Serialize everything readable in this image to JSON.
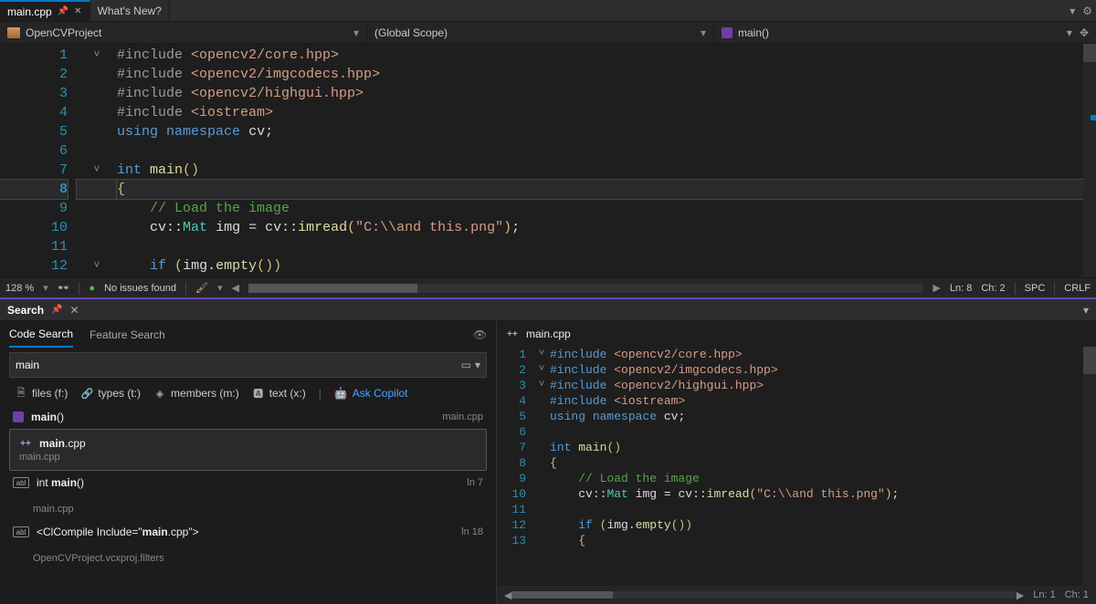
{
  "tabs": {
    "active": "main.cpp",
    "other": "What's New?"
  },
  "nav": {
    "project": "OpenCVProject",
    "scope": "(Global Scope)",
    "member": "main()"
  },
  "editor": {
    "current_line_num": "8",
    "lines": [
      {
        "n": "1",
        "fold": "˅",
        "html": "<span class='tok-pp'>#include</span> <span class='tok-str'>&lt;opencv2/core.hpp&gt;</span>"
      },
      {
        "n": "2",
        "fold": " ",
        "html": "<span class='tok-pp'>#include</span> <span class='tok-str'>&lt;opencv2/imgcodecs.hpp&gt;</span>"
      },
      {
        "n": "3",
        "fold": " ",
        "html": "<span class='tok-pp'>#include</span> <span class='tok-str'>&lt;opencv2/highgui.hpp&gt;</span>"
      },
      {
        "n": "4",
        "fold": " ",
        "html": "<span class='tok-pp'>#include</span> <span class='tok-str'>&lt;iostream&gt;</span>"
      },
      {
        "n": "5",
        "fold": " ",
        "html": "<span class='tok-kw'>using</span> <span class='tok-kw'>namespace</span> <span class='tok-white'>cv;</span>"
      },
      {
        "n": "6",
        "fold": " ",
        "html": " "
      },
      {
        "n": "7",
        "fold": "˅",
        "html": "<span class='tok-kw'>int</span> <span class='tok-func'>main</span><span class='tok-brace'>()</span>"
      },
      {
        "n": "8",
        "fold": " ",
        "html": "<span class='tok-brace'>{</span>",
        "current": true
      },
      {
        "n": "9",
        "fold": " ",
        "html": "    <span class='tok-cmt'>// Load the image</span>"
      },
      {
        "n": "10",
        "fold": " ",
        "html": "    <span class='tok-white'>cv::</span><span class='tok-type'>Mat</span> <span class='tok-white'>img = cv::</span><span class='tok-func'>imread</span><span class='tok-brace'>(</span><span class='tok-str'>\"C:\\\\and this.png\"</span><span class='tok-brace'>)</span><span class='tok-white'>;</span>"
      },
      {
        "n": "11",
        "fold": " ",
        "html": " "
      },
      {
        "n": "12",
        "fold": "˅",
        "html": "    <span class='tok-kw'>if</span> <span class='tok-brace'>(</span><span class='tok-white'>img.</span><span class='tok-func'>empty</span><span class='tok-brace'>())</span>"
      }
    ]
  },
  "status": {
    "zoom": "128 %",
    "issues": "No issues found",
    "ln": "Ln: 8",
    "ch": "Ch: 2",
    "spc": "SPC",
    "crlf": "CRLF"
  },
  "search": {
    "panel_title": "Search",
    "tab_code": "Code Search",
    "tab_feature": "Feature Search",
    "query": "main",
    "filters": {
      "files": "files (f:)",
      "types": "types (t:)",
      "members": "members (m:)",
      "text": "text (x:)",
      "ask": "Ask Copilot"
    },
    "results": [
      {
        "kind": "member",
        "title": "main()",
        "meta": "main.cpp"
      },
      {
        "kind": "file-box",
        "title": "main.cpp",
        "sub": "main.cpp"
      },
      {
        "kind": "def",
        "title": "int main()",
        "sub": "main.cpp",
        "meta": "ln 7"
      },
      {
        "kind": "ref",
        "title": "<ClCompile Include=\"main.cpp\">",
        "sub": "OpenCVProject.vcxproj.filters",
        "meta": "ln 18"
      }
    ]
  },
  "preview": {
    "filename": "main.cpp",
    "footer_ln": "Ln: 1",
    "footer_ch": "Ch: 1",
    "lines": [
      {
        "n": "1",
        "fold": "˅",
        "html": "<span class='tok-pp2'>#include</span> <span class='tok-str'>&lt;opencv2/core.hpp&gt;</span>"
      },
      {
        "n": "2",
        "fold": " ",
        "html": "<span class='tok-pp2'>#include</span> <span class='tok-str'>&lt;opencv2/imgcodecs.hpp&gt;</span>"
      },
      {
        "n": "3",
        "fold": " ",
        "html": "<span class='tok-pp2'>#include</span> <span class='tok-str'>&lt;opencv2/highgui.hpp&gt;</span>"
      },
      {
        "n": "4",
        "fold": " ",
        "html": "<span class='tok-pp2'>#include</span> <span class='tok-str'>&lt;iostream&gt;</span>"
      },
      {
        "n": "5",
        "fold": " ",
        "html": "<span class='tok-kw'>using</span> <span class='tok-kw'>namespace</span> <span class='tok-white'>cv;</span>"
      },
      {
        "n": "6",
        "fold": " ",
        "html": " "
      },
      {
        "n": "7",
        "fold": "˅",
        "html": "<span class='tok-kw'>int</span> <span class='tok-func'>main</span><span class='tok-brace'>()</span>"
      },
      {
        "n": "8",
        "fold": " ",
        "html": "<span class='tok-brace'>{</span>"
      },
      {
        "n": "9",
        "fold": " ",
        "html": "    <span class='tok-cmt'>// Load the image</span>"
      },
      {
        "n": "10",
        "fold": " ",
        "html": "    <span class='tok-white'>cv::</span><span class='tok-type'>Mat</span> <span class='tok-white'>img = cv::</span><span class='tok-func'>imread</span><span class='tok-brace'>(</span><span class='tok-str'>\"C:\\\\and this.png\"</span><span class='tok-brace'>)</span><span class='tok-white'>;</span>"
      },
      {
        "n": "11",
        "fold": " ",
        "html": " "
      },
      {
        "n": "12",
        "fold": "˅",
        "html": "    <span class='tok-kw'>if</span> <span class='tok-brace'>(</span><span class='tok-white'>img.</span><span class='tok-func'>empty</span><span class='tok-brace'>())</span>"
      },
      {
        "n": "13",
        "fold": " ",
        "html": "    <span class='tok-brace'>{</span>"
      }
    ]
  }
}
